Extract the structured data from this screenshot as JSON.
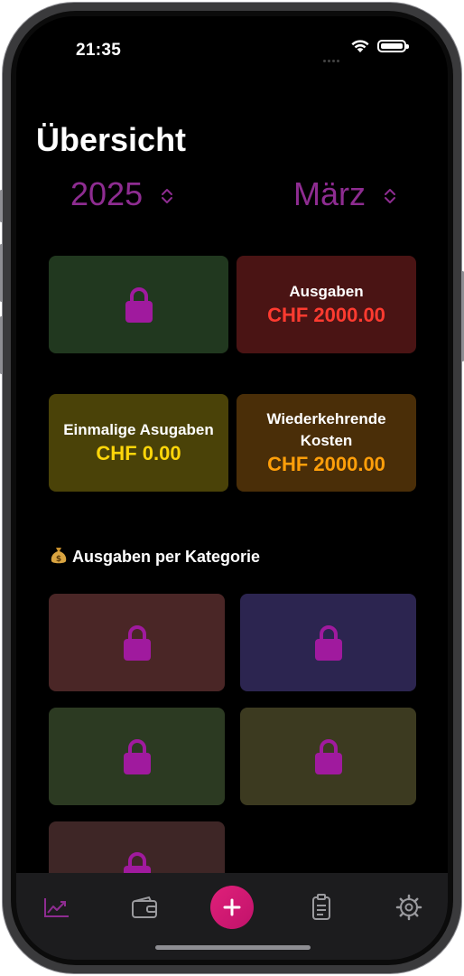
{
  "status_bar": {
    "time": "21:35"
  },
  "header": {
    "title": "Übersicht"
  },
  "pickers": {
    "year": "2025",
    "month": "März"
  },
  "summary": {
    "ausgaben": {
      "label": "Ausgaben",
      "value": "CHF 2000.00"
    },
    "einmalig": {
      "label": "Einmalige Asugaben",
      "value": "CHF 0.00"
    },
    "wiederkehrend": {
      "label_line1": "Wiederkehrende",
      "label_line2": "Kosten",
      "value": "CHF 2000.00"
    }
  },
  "categories": {
    "section_title": "Ausgaben per Kategorie"
  },
  "tabs": [
    {
      "icon": "chart-icon",
      "active": true
    },
    {
      "icon": "wallet-icon",
      "active": false
    },
    {
      "icon": "plus-icon",
      "active": false
    },
    {
      "icon": "clipboard-icon",
      "active": false
    },
    {
      "icon": "gear-icon",
      "active": false
    }
  ],
  "colors": {
    "accent": "#8e2c91",
    "lock": "#a01a9e",
    "expense_red": "#ff3b30",
    "yellow_value": "#ffd60a",
    "orange_value": "#ff9f0a",
    "add_button": "#e0207a"
  }
}
